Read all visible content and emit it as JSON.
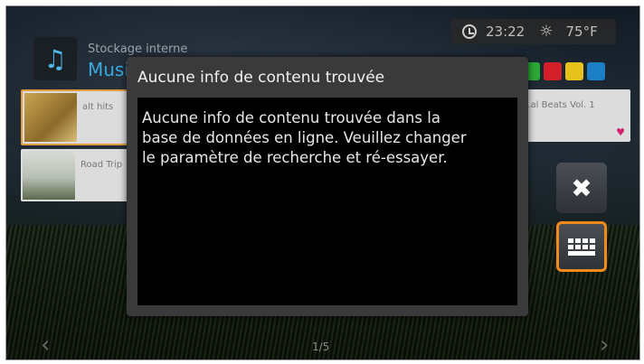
{
  "status_bar": {
    "time": "23:22",
    "temperature": "75°F",
    "clock_icon": "clock-icon",
    "weather_icon": "sun-icon"
  },
  "header": {
    "storage_label": "Stockage interne",
    "section_label": "Musique",
    "icon": "music-note-icon"
  },
  "color_buttons": [
    {
      "name": "green-button",
      "color": "#2aa836"
    },
    {
      "name": "red-button",
      "color": "#d21f2a"
    },
    {
      "name": "yellow-button",
      "color": "#e6c21a"
    },
    {
      "name": "blue-button",
      "color": "#1c7fc4"
    }
  ],
  "tiles": [
    {
      "title": "alt hits"
    },
    {
      "title": "Road Trip"
    },
    {
      "title": "...al Beats Vol. 1"
    }
  ],
  "dialog": {
    "title": "Aucune info de contenu trouvée",
    "message": "Aucune info de contenu trouvée dans la\nbase de données en ligne. Veuillez changer\nle paramètre de recherche et ré-essayer."
  },
  "side_buttons": {
    "close_icon": "close-icon",
    "keyboard_icon": "keyboard-icon"
  },
  "pager": "1/5",
  "accent_color": "#f08a1c"
}
